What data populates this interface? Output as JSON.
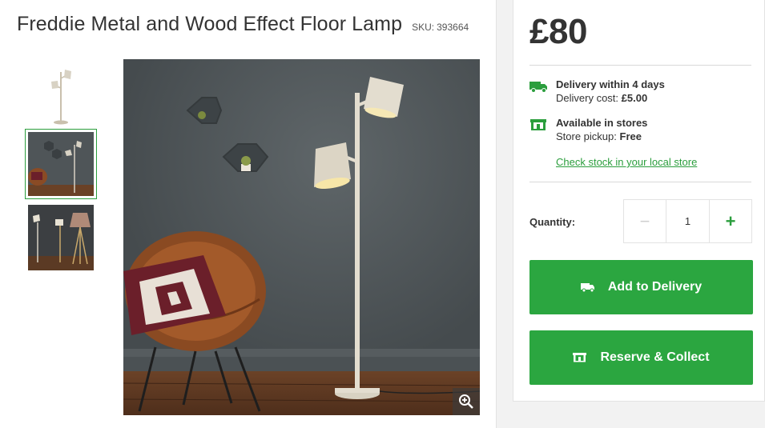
{
  "product": {
    "title": "Freddie Metal and Wood Effect Floor Lamp",
    "sku_label": "SKU:",
    "sku_value": "393664",
    "price": "£80"
  },
  "delivery": {
    "title": "Delivery within 4 days",
    "cost_label": "Delivery cost:",
    "cost_value": "£5.00",
    "icon": "truck-icon"
  },
  "stores": {
    "title": "Available in stores",
    "pickup_label": "Store pickup:",
    "pickup_value": "Free",
    "icon": "store-icon"
  },
  "stock_link": "Check stock in your local store",
  "quantity": {
    "label": "Quantity:",
    "value": "1",
    "minus": "−",
    "plus": "+"
  },
  "buttons": {
    "add_delivery": "Add to Delivery",
    "reserve_collect": "Reserve & Collect"
  },
  "colors": {
    "accent": "#2ba640",
    "link": "#2b9e3d",
    "wall": "#4f5558"
  }
}
